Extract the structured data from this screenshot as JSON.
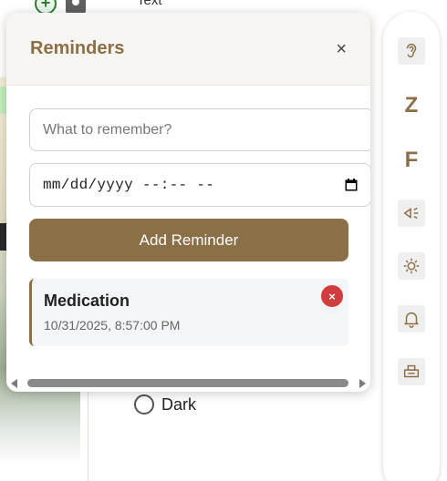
{
  "background": {
    "text_label": "Text",
    "theme_option": "Dark"
  },
  "rail": {
    "items": [
      {
        "icon": "ear-icon"
      },
      {
        "label": "Z"
      },
      {
        "label": "F"
      },
      {
        "icon": "speaker-icon"
      },
      {
        "icon": "sun-icon"
      },
      {
        "icon": "bell-icon"
      },
      {
        "icon": "print-icon"
      }
    ]
  },
  "reminders": {
    "title": "Reminders",
    "close_label": "×",
    "input_placeholder": "What to remember?",
    "date_value": "mm/dd/yyyy --:-- --",
    "add_label": "Add Reminder",
    "items": [
      {
        "title": "Medication",
        "datetime": "10/31/2025, 8:57:00 PM",
        "delete_label": "×"
      }
    ]
  },
  "colors": {
    "accent": "#8b6f47",
    "delete": "#d13c3c"
  }
}
